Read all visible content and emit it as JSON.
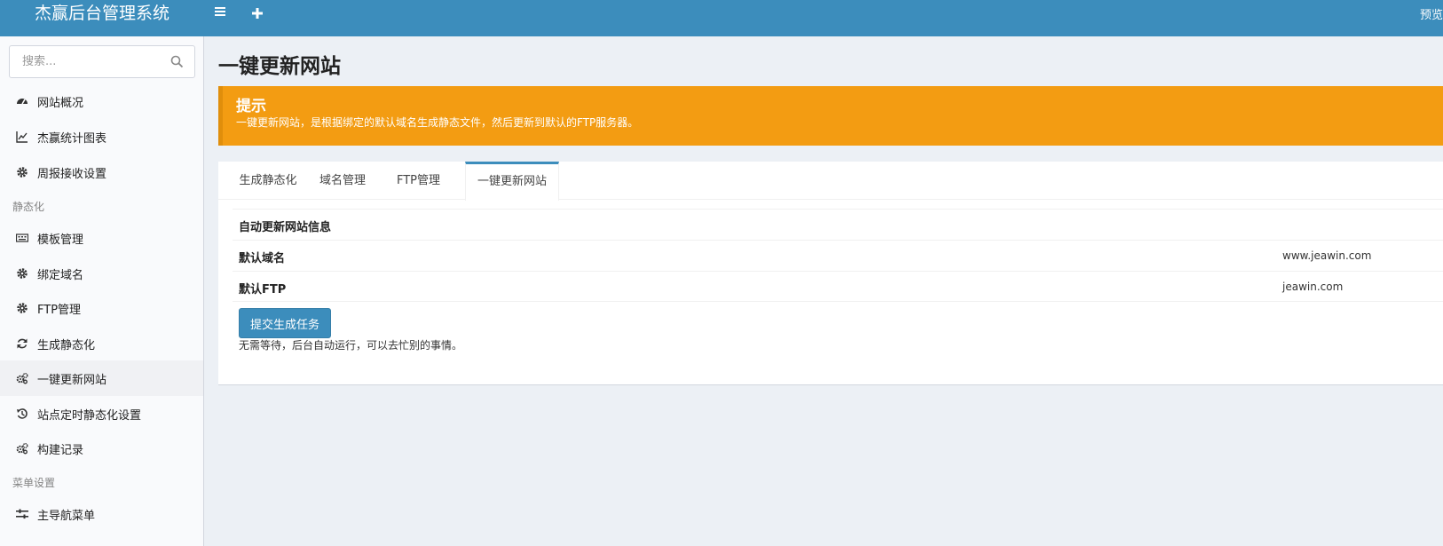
{
  "header": {
    "brand": "杰赢后台管理系统",
    "menu_icon": "hamburger-icon",
    "plus_icon": "plus-icon",
    "preview_label": "预览"
  },
  "sidebar": {
    "search_placeholder": "搜索...",
    "items": [
      {
        "label": "网站概况",
        "icon": "dashboard-icon"
      },
      {
        "label": "杰赢统计图表",
        "icon": "line-chart-icon"
      },
      {
        "label": "周报接收设置",
        "icon": "gear-icon"
      },
      {
        "label": "模板管理",
        "icon": "keyboard-icon"
      },
      {
        "label": "绑定域名",
        "icon": "gear-icon"
      },
      {
        "label": "FTP管理",
        "icon": "gear-icon"
      },
      {
        "label": "生成静态化",
        "icon": "refresh-icon"
      },
      {
        "label": "一键更新网站",
        "icon": "gears-icon"
      },
      {
        "label": "站点定时静态化设置",
        "icon": "history-icon"
      },
      {
        "label": "构建记录",
        "icon": "gears-icon"
      },
      {
        "label": "主导航菜单",
        "icon": "sliders-icon"
      }
    ],
    "headers": [
      "静态化",
      "菜单设置"
    ],
    "active_index": 7
  },
  "main": {
    "title": "一键更新网站",
    "callout": {
      "title": "提示",
      "text": "一键更新网站，是根据绑定的默认域名生成静态文件，然后更新到默认的FTP服务器。",
      "color": "#f39c12"
    },
    "tabs": [
      {
        "label": "生成静态化"
      },
      {
        "label": "域名管理"
      },
      {
        "label": "FTP管理"
      },
      {
        "label": "一键更新网站"
      }
    ],
    "active_tab": 3,
    "info": {
      "heading": "自动更新网站信息",
      "rows": [
        {
          "key": "默认域名",
          "value": "www.jeawin.com"
        },
        {
          "key": "默认FTP",
          "value": "jeawin.com"
        }
      ]
    },
    "submit_label": "提交生成任务",
    "help_text": "无需等待，后台自动运行，可以去忙别的事情。"
  },
  "colors": {
    "primary": "#3c8dbc",
    "warning": "#f39c12"
  }
}
